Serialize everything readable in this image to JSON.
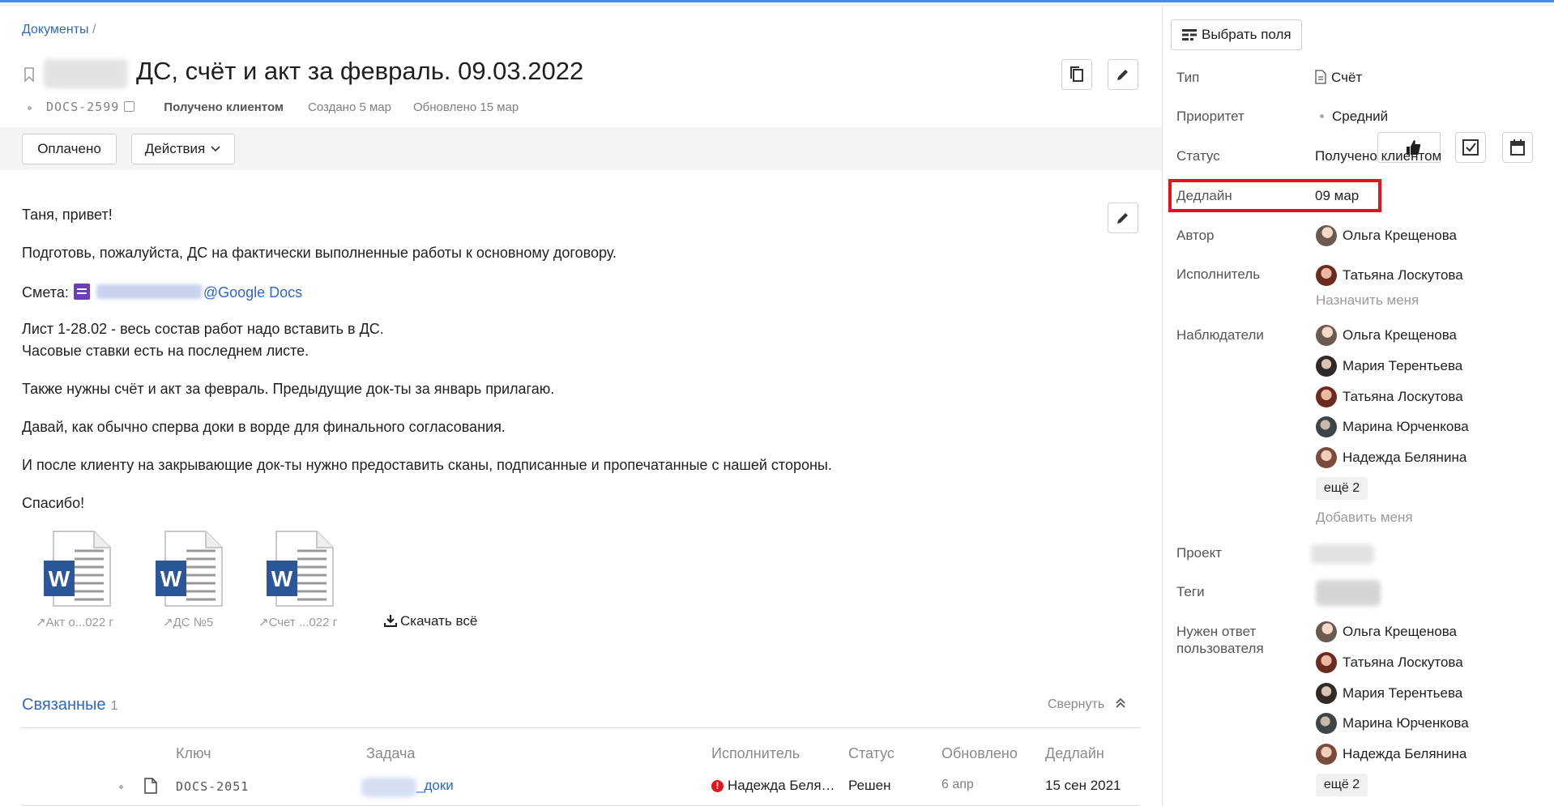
{
  "breadcrumb": {
    "link": "Документы",
    "sep": "/"
  },
  "issue": {
    "title": "ДС, счёт и акт за февраль. 09.03.2022",
    "key": "DOCS-2599",
    "status_text": "Получено клиентом",
    "created": "Создано 5 мар",
    "updated": "Обновлено 15 мар"
  },
  "actions": {
    "paid_button": "Оплачено",
    "actions_button": "Действия"
  },
  "description": {
    "greeting": "Таня, привет!",
    "line1": "Подготовь, пожалуйста, ДС на фактически выполненные работы к основному договору.",
    "smeta_label": "Смета:",
    "smeta_link": "@Google Docs",
    "line2": "Лист 1-28.02 - весь состав работ надо вставить в ДС.",
    "line3": "Часовые ставки есть на последнем листе.",
    "line4": "Также нужны счёт и акт за февраль. Предыдущие док-ты за январь прилагаю.",
    "line5": "Давай, как обычно сперва доки в ворде для финального согласования.",
    "line6": "И после клиенту на закрывающие док-ты нужно предоставить сканы, подписанные и пропечатанные с нашей стороны.",
    "thanks": "Спасибо!"
  },
  "attachments": [
    {
      "name": "Акт о...022 г"
    },
    {
      "name": "ДС №5"
    },
    {
      "name": "Счет ...022 г"
    }
  ],
  "download_all": "Скачать всё",
  "related": {
    "heading": "Связанные",
    "count": "1",
    "collapse": "Свернуть",
    "columns": [
      "Ключ",
      "Задача",
      "Исполнитель",
      "Статус",
      "Обновлено",
      "Дедлайн"
    ],
    "rows": [
      {
        "key": "DOCS-2051",
        "task": "_доки",
        "assignee": "Надежда Беля…",
        "status": "Решен",
        "updated": "6 апр",
        "deadline": "15 сен 2021"
      }
    ]
  },
  "sidebar": {
    "choose_fields": "Выбрать поля",
    "type_label": "Тип",
    "type_value": "Счёт",
    "priority_label": "Приоритет",
    "priority_value": "Средний",
    "status_label": "Статус",
    "status_value": "Получено клиентом",
    "deadline_label": "Дедлайн",
    "deadline_value": "09 мар",
    "author_label": "Автор",
    "author": "Ольга Крещенова",
    "assignee_label": "Исполнитель",
    "assignee": "Татьяна Лоскутова",
    "assign_me": "Назначить меня",
    "watchers_label": "Наблюдатели",
    "watchers": [
      "Ольга Крещенова",
      "Мария Терентьева",
      "Татьяна Лоскутова",
      "Марина Юрченкова",
      "Надежда Белянина"
    ],
    "watchers_more": "ещё 2",
    "add_me": "Добавить меня",
    "project_label": "Проект",
    "tags_label": "Теги",
    "needs_reply_label_1": "Нужен ответ",
    "needs_reply_label_2": "пользователя",
    "needs_reply": [
      "Ольга Крещенова",
      "Татьяна Лоскутова",
      "Мария Терентьева",
      "Марина Юрченкова",
      "Надежда Белянина"
    ],
    "needs_reply_more": "ещё 2"
  },
  "colors": {
    "accent": "#2f66c9",
    "highlight": "#e8101a",
    "word_blue": "#2b579a"
  }
}
